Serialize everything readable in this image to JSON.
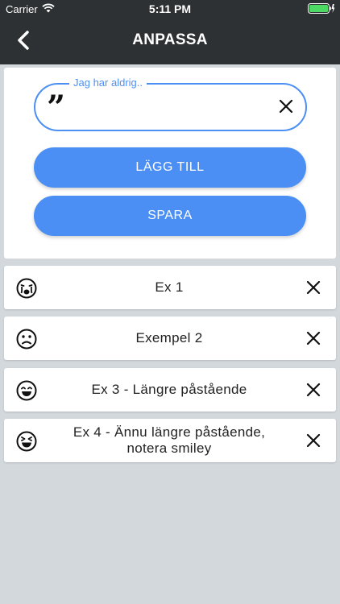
{
  "status_bar": {
    "carrier": "Carrier",
    "time": "5:11 PM"
  },
  "nav": {
    "title": "ANPASSA"
  },
  "form": {
    "label": "Jag har aldrig..",
    "value": "",
    "add_label": "LÄGG TILL",
    "save_label": "SPARA"
  },
  "statements": [
    {
      "text": "Ex 1",
      "icon": "crying-face-icon"
    },
    {
      "text": "Exempel 2",
      "icon": "sad-face-icon"
    },
    {
      "text": "Ex 3 - Längre påstående",
      "icon": "happy-face-icon"
    },
    {
      "text": "Ex 4 - Ännu längre påstående, notera smiley",
      "icon": "laughing-face-icon"
    }
  ],
  "colors": {
    "accent": "#4b8ff5",
    "topbar": "#2e3133",
    "background": "#d3d8dd",
    "battery": "#4cd964"
  }
}
